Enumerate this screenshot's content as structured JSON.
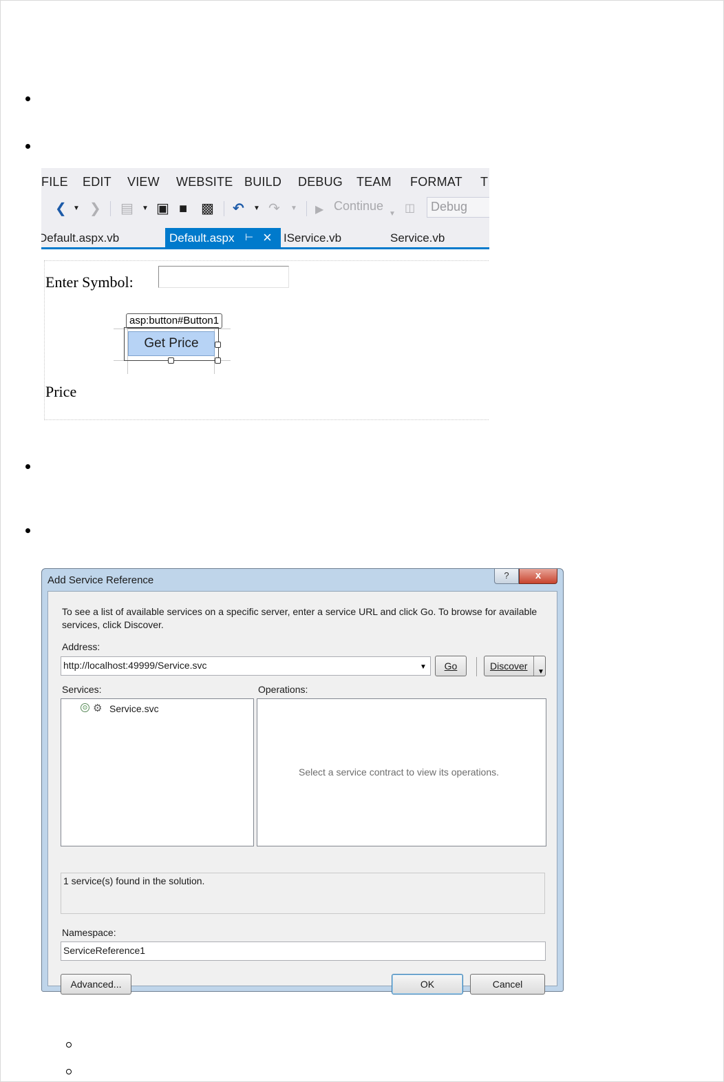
{
  "vs": {
    "menu": [
      "FILE",
      "EDIT",
      "VIEW",
      "WEBSITE",
      "BUILD",
      "DEBUG",
      "TEAM",
      "FORMAT",
      "T"
    ],
    "toolbar": {
      "continue_label": "Continue",
      "config_value": "Debug",
      "icons": [
        "back-icon",
        "forward-icon",
        "new-project-icon",
        "open-icon",
        "save-icon",
        "save-all-icon",
        "undo-icon",
        "redo-icon",
        "start-icon",
        "attach-icon"
      ]
    },
    "tabs": {
      "items": [
        "Default.aspx.vb",
        "Default.aspx",
        "IService.vb",
        "Service.vb"
      ],
      "active": "Default.aspx"
    },
    "designer": {
      "symbol_label": "Enter Symbol:",
      "symbol_value": "",
      "button_tag": "asp:button#Button1",
      "button_label": "Get Price",
      "price_label": "Price"
    }
  },
  "dialog": {
    "title": "Add Service Reference",
    "help_label": "?",
    "close_label": "x",
    "description": "To see a list of available services on a specific server, enter a service URL and click Go. To browse for available services, click Discover.",
    "address_label": "Address:",
    "address_value": "http://localhost:49999/Service.svc",
    "go_label": "Go",
    "discover_label": "Discover",
    "services_label": "Services:",
    "operations_label": "Operations:",
    "services": [
      "Service.svc"
    ],
    "operations_hint": "Select a service contract to view its operations.",
    "status": "1 service(s) found in the solution.",
    "namespace_label": "Namespace:",
    "namespace_value": "ServiceReference1",
    "advanced_label": "Advanced...",
    "ok_label": "OK",
    "cancel_label": "Cancel"
  }
}
